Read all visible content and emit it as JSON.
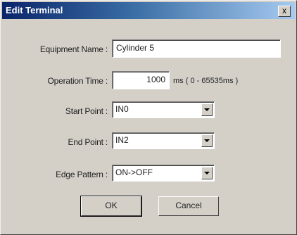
{
  "window": {
    "title": "Edit Terminal",
    "close_label": "x"
  },
  "fields": {
    "equipment_name": {
      "label": "Equipment Name :",
      "value": "Cylinder 5"
    },
    "operation_time": {
      "label": "Operation Time :",
      "value": "1000",
      "hint": "ms ( 0 - 65535ms )"
    },
    "start_point": {
      "label": "Start Point :",
      "value": "IN0"
    },
    "end_point": {
      "label": "End Point :",
      "value": "IN2"
    },
    "edge_pattern": {
      "label": "Edge Pattern :",
      "value": "ON->OFF"
    }
  },
  "buttons": {
    "ok": "OK",
    "cancel": "Cancel"
  }
}
